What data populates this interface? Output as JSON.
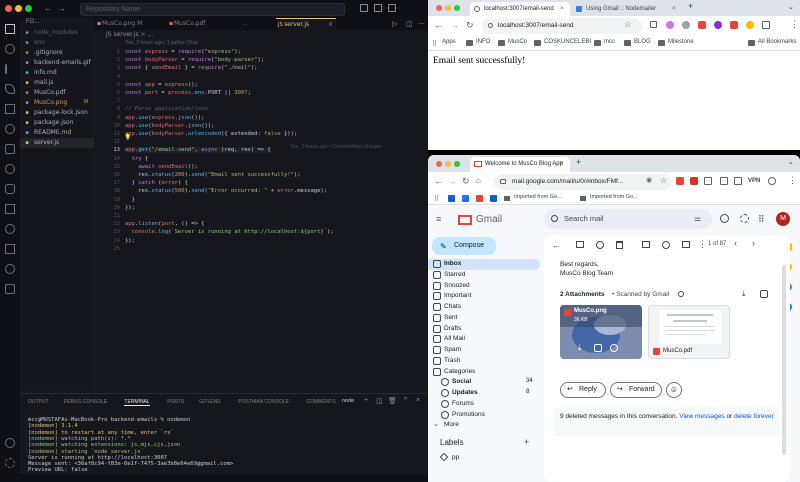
{
  "vscode": {
    "search_placeholder": "Repository Name",
    "explorer_title": "FO...",
    "tabs": [
      "MusCo.png M",
      "MusCo.pdf",
      "server.js"
    ],
    "active_tab": "server.js",
    "breadcrumb": "JS server.js > ...",
    "blame": "You, 2 hours ago | 1 author (You)",
    "inline_blame": "You, 2 hours ago • Uncommitted changes",
    "files": [
      {
        "name": "node_modules",
        "icon": "folder-icon",
        "color": "#8a8f9a",
        "dim": true
      },
      {
        "name": "env",
        "icon": "env-icon",
        "color": "#8a8f9a",
        "dim": true
      },
      {
        "name": ".gitignore",
        "icon": "git-icon",
        "color": "#e06c75"
      },
      {
        "name": "backend-emails.gif",
        "icon": "image-icon",
        "color": "#c678dd"
      },
      {
        "name": "info.md",
        "icon": "info-icon",
        "color": "#61afef"
      },
      {
        "name": "mail.js",
        "icon": "js-icon",
        "color": "#e5c07b"
      },
      {
        "name": "MusCo.pdf",
        "icon": "pdf-icon",
        "color": "#e06c75"
      },
      {
        "name": "MusCo.png",
        "icon": "image-icon",
        "color": "#c678dd",
        "badge": "M"
      },
      {
        "name": "package-lock.json",
        "icon": "json-icon",
        "color": "#e5c07b"
      },
      {
        "name": "package.json",
        "icon": "json-icon",
        "color": "#e5c07b"
      },
      {
        "name": "README.md",
        "icon": "info-icon",
        "color": "#61afef"
      },
      {
        "name": "server.js",
        "icon": "js-icon",
        "color": "#e5c07b",
        "active": true
      }
    ],
    "code_lines": [
      "const express = require(\"express\");",
      "const bodyParser = require(\"body-parser\");",
      "const { sendEmail } = require(\"./mail\");",
      "",
      "const app = express();",
      "const port = process.env.PORT || 3007;",
      "",
      "// Parse application/json",
      "app.use(express.json());",
      "app.use(bodyParser.json());",
      "app.use(bodyParser.urlencoded({ extended: false }));",
      "",
      "app.get(\"/email-send\", async (req, res) => {",
      "  try {",
      "    await sendEmail();",
      "    res.status(200).send(\"Email sent successfully!\");",
      "  } catch (error) {",
      "    res.status(500).send(\"Error occurred: \" + error.message);",
      "  }",
      "});",
      "",
      "app.listen(port, () => {",
      "  console.log(`Server is running at http://localhost:${port}`);",
      "});",
      ""
    ],
    "panel_tabs": [
      "OUTPUT",
      "DEBUG CONSOLE",
      "TERMINAL",
      "PORTS",
      "GITLENS",
      "POSTMAN CONSOLE",
      "COMMENTS"
    ],
    "active_panel_tab": "TERMINAL",
    "terminal_label": "node",
    "terminal_lines": [
      "mcc@MUSTAFAs-MacBook-Pro backend-emails % nodemon",
      "[nodemon] 3.1.4",
      "[nodemon] to restart at any time, enter `rs`",
      "[nodemon] watching path(s): *.*",
      "[nodemon] watching extensions: js,mjs,cjs,json",
      "[nodemon] starting `node server.js`",
      "Server is running at http://localhost:3007",
      "Message sent: <36af8c94-f83e-0e1f-7475-3ae3b8e64e69@gmail.com>",
      "Preview URL: false"
    ]
  },
  "browser1": {
    "tabs": [
      "localhost:3007/email-send",
      "Using Gmail :: Nodemailer"
    ],
    "url": "localhost:3007/email-send",
    "bookmarks": [
      "Apps",
      "INFO",
      "MusCo",
      "COSKUNCELEBI",
      "mcc",
      "BLOG",
      "Milestone"
    ],
    "all_bookmarks": "All Bookmarks",
    "body_text": "Email sent successfully!"
  },
  "gmail": {
    "tab": "Welcome to MusCo Blog App",
    "url": "mail.google.com/mail/u/0/#inbox/FMf...",
    "vpn": "VPN",
    "bookmark": "Imported from Go...",
    "bookmark2": "Imported from Go...",
    "brand": "Gmail",
    "search_placeholder": "Search mail",
    "avatar": "M",
    "compose": "Compose",
    "nav": [
      {
        "label": "Inbox",
        "icon": "inbox-icon",
        "active": true
      },
      {
        "label": "Starred",
        "icon": "star-icon"
      },
      {
        "label": "Snoozed",
        "icon": "clock-icon"
      },
      {
        "label": "Important",
        "icon": "important-icon"
      },
      {
        "label": "Chats",
        "icon": "chat-icon"
      },
      {
        "label": "Sent",
        "icon": "send-icon"
      },
      {
        "label": "Drafts",
        "icon": "draft-icon"
      },
      {
        "label": "All Mail",
        "icon": "all-mail-icon"
      },
      {
        "label": "Spam",
        "icon": "spam-icon"
      },
      {
        "label": "Trash",
        "icon": "trash-icon"
      },
      {
        "label": "Categories",
        "icon": "chevron-down-icon"
      }
    ],
    "categories": [
      {
        "label": "Social",
        "count": "34",
        "bold": true
      },
      {
        "label": "Updates",
        "count": "8",
        "bold": true
      },
      {
        "label": "Forums",
        "count": ""
      },
      {
        "label": "Promotions",
        "count": ""
      }
    ],
    "more": "More",
    "labels_title": "Labels",
    "label_items": [
      "pp"
    ],
    "pagination": "1 of 87",
    "body_lines": [
      "Best regards,",
      "MusCo Blog Team"
    ],
    "attachments_title": "2 Attachments",
    "scanned": "• Scanned by Gmail",
    "att1_name": "MusCo.png",
    "att1_size": "36 KB",
    "att2_name": "MusCo.pdf",
    "reply": "Reply",
    "forward": "Forward",
    "deleted_pre": "9 deleted messages in this conversation. ",
    "view_link": "View messages",
    "or_text": " or ",
    "delete_link": "delete forever",
    "colors": {
      "compose": "#c2e7ff",
      "inbox_active": "#d3e3fd",
      "link": "#0b57d0",
      "red": "#ea4335"
    }
  }
}
